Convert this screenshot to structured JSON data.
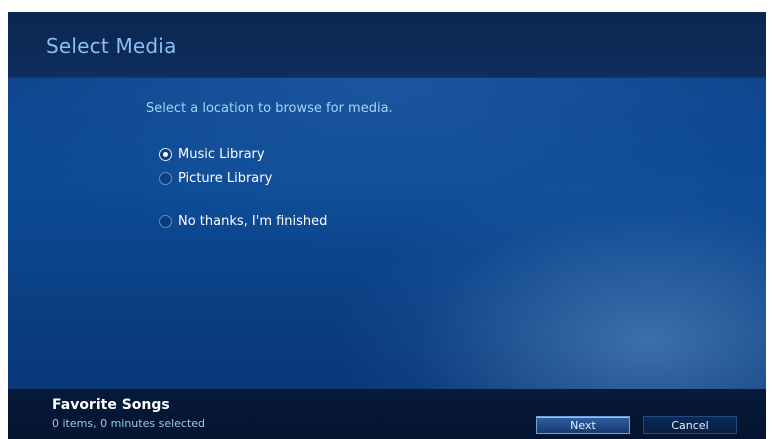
{
  "dialog": {
    "title": "Select Media",
    "prompt": "Select a location to browse for media.",
    "options": [
      {
        "label": "Music Library",
        "selected": true
      },
      {
        "label": "Picture Library",
        "selected": false
      },
      {
        "label": "No thanks, I'm finished",
        "selected": false
      }
    ]
  },
  "footer": {
    "title": "Favorite Songs",
    "subtitle": "0 items, 0 minutes selected",
    "next_label": "Next",
    "cancel_label": "Cancel"
  },
  "colors": {
    "accent": "#8ebdf0",
    "background": "#0d4b96"
  }
}
